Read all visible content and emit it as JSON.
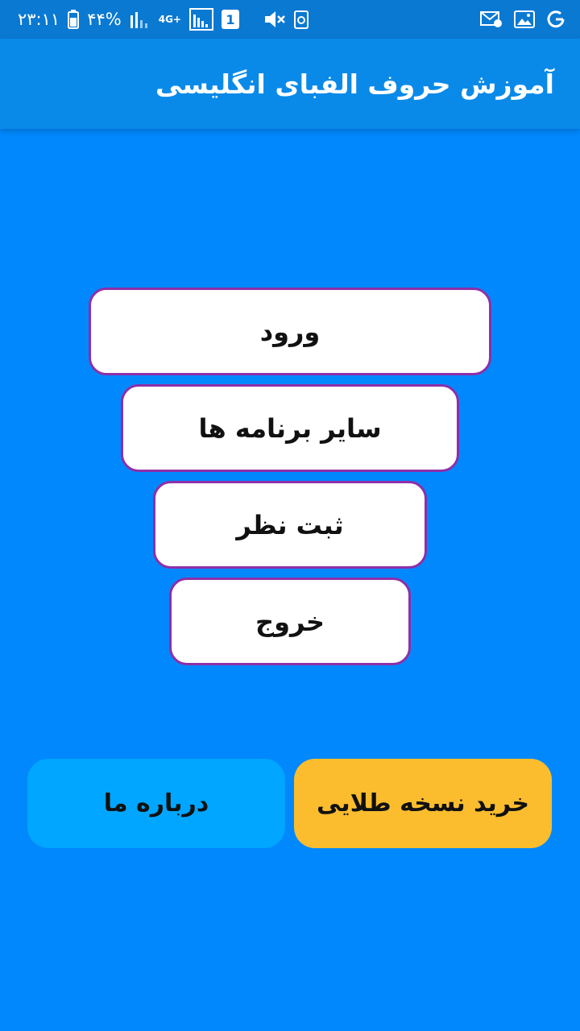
{
  "status_bar": {
    "time": "۲۳:۱۱",
    "battery_percent": "۴۴%",
    "network_type": "4G+",
    "sim_slot": "1",
    "icons": [
      "battery-icon",
      "signal-icon",
      "network-4g-icon",
      "signal-icon",
      "sim-icon",
      "mute-icon",
      "recycle-icon",
      "mail-settings-icon",
      "image-icon",
      "google-icon"
    ]
  },
  "app_bar": {
    "title": "آموزش حروف الفبای انگلیسی"
  },
  "menu": {
    "login_label": "ورود",
    "other_apps_label": "سایر برنامه ها",
    "rate_label": "ثبت نظر",
    "exit_label": "خروج"
  },
  "bottom": {
    "about_label": "درباره ما",
    "gold_label": "خرید نسخه طلایی"
  },
  "colors": {
    "background": "#0088FC",
    "status_bar": "#0A79D2",
    "app_bar": "#0A8AE8",
    "button_border": "#8E2FA8",
    "about_button": "#00A6FF",
    "gold_button": "#FBBD2E"
  }
}
